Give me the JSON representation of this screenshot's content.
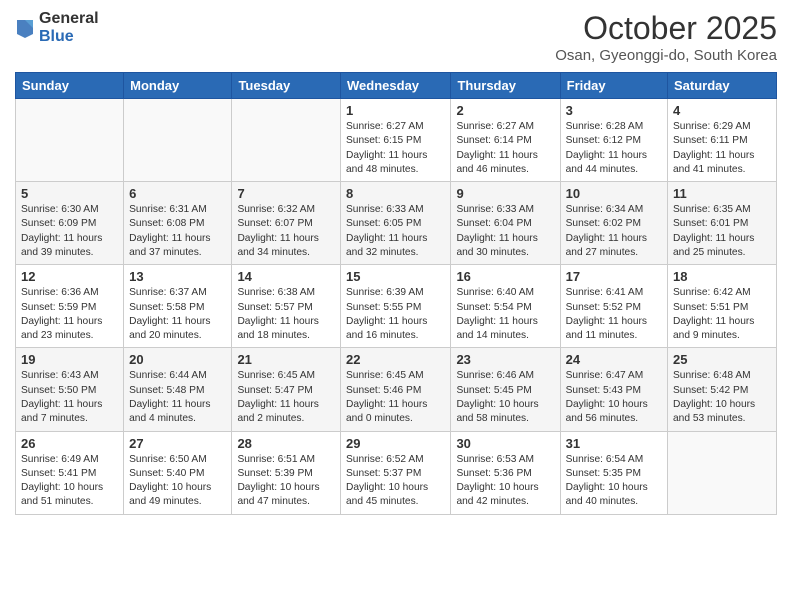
{
  "header": {
    "logo_general": "General",
    "logo_blue": "Blue",
    "month_title": "October 2025",
    "subtitle": "Osan, Gyeonggi-do, South Korea"
  },
  "weekdays": [
    "Sunday",
    "Monday",
    "Tuesday",
    "Wednesday",
    "Thursday",
    "Friday",
    "Saturday"
  ],
  "weeks": [
    [
      {
        "day": "",
        "sunrise": "",
        "sunset": "",
        "daylight": ""
      },
      {
        "day": "",
        "sunrise": "",
        "sunset": "",
        "daylight": ""
      },
      {
        "day": "",
        "sunrise": "",
        "sunset": "",
        "daylight": ""
      },
      {
        "day": "1",
        "sunrise": "Sunrise: 6:27 AM",
        "sunset": "Sunset: 6:15 PM",
        "daylight": "Daylight: 11 hours and 48 minutes."
      },
      {
        "day": "2",
        "sunrise": "Sunrise: 6:27 AM",
        "sunset": "Sunset: 6:14 PM",
        "daylight": "Daylight: 11 hours and 46 minutes."
      },
      {
        "day": "3",
        "sunrise": "Sunrise: 6:28 AM",
        "sunset": "Sunset: 6:12 PM",
        "daylight": "Daylight: 11 hours and 44 minutes."
      },
      {
        "day": "4",
        "sunrise": "Sunrise: 6:29 AM",
        "sunset": "Sunset: 6:11 PM",
        "daylight": "Daylight: 11 hours and 41 minutes."
      }
    ],
    [
      {
        "day": "5",
        "sunrise": "Sunrise: 6:30 AM",
        "sunset": "Sunset: 6:09 PM",
        "daylight": "Daylight: 11 hours and 39 minutes."
      },
      {
        "day": "6",
        "sunrise": "Sunrise: 6:31 AM",
        "sunset": "Sunset: 6:08 PM",
        "daylight": "Daylight: 11 hours and 37 minutes."
      },
      {
        "day": "7",
        "sunrise": "Sunrise: 6:32 AM",
        "sunset": "Sunset: 6:07 PM",
        "daylight": "Daylight: 11 hours and 34 minutes."
      },
      {
        "day": "8",
        "sunrise": "Sunrise: 6:33 AM",
        "sunset": "Sunset: 6:05 PM",
        "daylight": "Daylight: 11 hours and 32 minutes."
      },
      {
        "day": "9",
        "sunrise": "Sunrise: 6:33 AM",
        "sunset": "Sunset: 6:04 PM",
        "daylight": "Daylight: 11 hours and 30 minutes."
      },
      {
        "day": "10",
        "sunrise": "Sunrise: 6:34 AM",
        "sunset": "Sunset: 6:02 PM",
        "daylight": "Daylight: 11 hours and 27 minutes."
      },
      {
        "day": "11",
        "sunrise": "Sunrise: 6:35 AM",
        "sunset": "Sunset: 6:01 PM",
        "daylight": "Daylight: 11 hours and 25 minutes."
      }
    ],
    [
      {
        "day": "12",
        "sunrise": "Sunrise: 6:36 AM",
        "sunset": "Sunset: 5:59 PM",
        "daylight": "Daylight: 11 hours and 23 minutes."
      },
      {
        "day": "13",
        "sunrise": "Sunrise: 6:37 AM",
        "sunset": "Sunset: 5:58 PM",
        "daylight": "Daylight: 11 hours and 20 minutes."
      },
      {
        "day": "14",
        "sunrise": "Sunrise: 6:38 AM",
        "sunset": "Sunset: 5:57 PM",
        "daylight": "Daylight: 11 hours and 18 minutes."
      },
      {
        "day": "15",
        "sunrise": "Sunrise: 6:39 AM",
        "sunset": "Sunset: 5:55 PM",
        "daylight": "Daylight: 11 hours and 16 minutes."
      },
      {
        "day": "16",
        "sunrise": "Sunrise: 6:40 AM",
        "sunset": "Sunset: 5:54 PM",
        "daylight": "Daylight: 11 hours and 14 minutes."
      },
      {
        "day": "17",
        "sunrise": "Sunrise: 6:41 AM",
        "sunset": "Sunset: 5:52 PM",
        "daylight": "Daylight: 11 hours and 11 minutes."
      },
      {
        "day": "18",
        "sunrise": "Sunrise: 6:42 AM",
        "sunset": "Sunset: 5:51 PM",
        "daylight": "Daylight: 11 hours and 9 minutes."
      }
    ],
    [
      {
        "day": "19",
        "sunrise": "Sunrise: 6:43 AM",
        "sunset": "Sunset: 5:50 PM",
        "daylight": "Daylight: 11 hours and 7 minutes."
      },
      {
        "day": "20",
        "sunrise": "Sunrise: 6:44 AM",
        "sunset": "Sunset: 5:48 PM",
        "daylight": "Daylight: 11 hours and 4 minutes."
      },
      {
        "day": "21",
        "sunrise": "Sunrise: 6:45 AM",
        "sunset": "Sunset: 5:47 PM",
        "daylight": "Daylight: 11 hours and 2 minutes."
      },
      {
        "day": "22",
        "sunrise": "Sunrise: 6:45 AM",
        "sunset": "Sunset: 5:46 PM",
        "daylight": "Daylight: 11 hours and 0 minutes."
      },
      {
        "day": "23",
        "sunrise": "Sunrise: 6:46 AM",
        "sunset": "Sunset: 5:45 PM",
        "daylight": "Daylight: 10 hours and 58 minutes."
      },
      {
        "day": "24",
        "sunrise": "Sunrise: 6:47 AM",
        "sunset": "Sunset: 5:43 PM",
        "daylight": "Daylight: 10 hours and 56 minutes."
      },
      {
        "day": "25",
        "sunrise": "Sunrise: 6:48 AM",
        "sunset": "Sunset: 5:42 PM",
        "daylight": "Daylight: 10 hours and 53 minutes."
      }
    ],
    [
      {
        "day": "26",
        "sunrise": "Sunrise: 6:49 AM",
        "sunset": "Sunset: 5:41 PM",
        "daylight": "Daylight: 10 hours and 51 minutes."
      },
      {
        "day": "27",
        "sunrise": "Sunrise: 6:50 AM",
        "sunset": "Sunset: 5:40 PM",
        "daylight": "Daylight: 10 hours and 49 minutes."
      },
      {
        "day": "28",
        "sunrise": "Sunrise: 6:51 AM",
        "sunset": "Sunset: 5:39 PM",
        "daylight": "Daylight: 10 hours and 47 minutes."
      },
      {
        "day": "29",
        "sunrise": "Sunrise: 6:52 AM",
        "sunset": "Sunset: 5:37 PM",
        "daylight": "Daylight: 10 hours and 45 minutes."
      },
      {
        "day": "30",
        "sunrise": "Sunrise: 6:53 AM",
        "sunset": "Sunset: 5:36 PM",
        "daylight": "Daylight: 10 hours and 42 minutes."
      },
      {
        "day": "31",
        "sunrise": "Sunrise: 6:54 AM",
        "sunset": "Sunset: 5:35 PM",
        "daylight": "Daylight: 10 hours and 40 minutes."
      },
      {
        "day": "",
        "sunrise": "",
        "sunset": "",
        "daylight": ""
      }
    ]
  ]
}
